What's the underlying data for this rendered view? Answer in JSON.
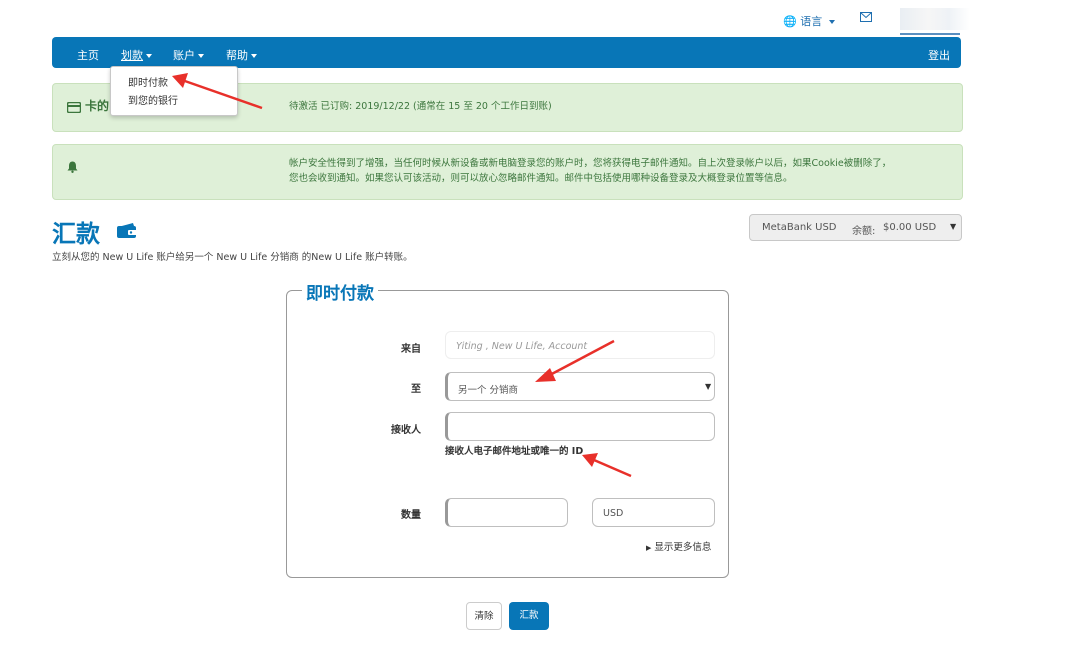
{
  "topbar": {
    "language_label": "语言",
    "globe_icon": "globe-icon",
    "mail_icon": "envelope-icon"
  },
  "nav": {
    "items": [
      "主页",
      "划款",
      "账户",
      "帮助"
    ],
    "logout": "登出"
  },
  "dropdown": {
    "items": [
      "即时付款",
      "到您的银行"
    ]
  },
  "alert1": {
    "title": "卡的",
    "text": "待激活 已订购: 2019/12/22 (通常在 15 至 20 个工作日到账)"
  },
  "alert2": {
    "icon": "bell-icon",
    "line1": "帐户安全性得到了增强，当任何时候从新设备或新电脑登录您的账户时，您将获得电子邮件通知。自上次登录帐户以后，如果Cookie被删除了，",
    "line2": "您也会收到通知。如果您认可该活动，则可以放心忽略邮件通知。邮件中包括使用哪种设备登录及大概登录位置等信息。"
  },
  "heading": {
    "title": "汇款",
    "subtitle": "立刻从您的 New U Life 账户给另一个 New U Life 分销商 的New U Life 账户转账。"
  },
  "account": {
    "name": "MetaBank USD",
    "balance_label": "余额:",
    "balance": "$0.00 USD"
  },
  "form": {
    "legend": "即时付款",
    "from_label": "来自",
    "from_placeholder": "Yiting , New U Life, Account",
    "to_label": "至",
    "to_value": "另一个 分销商",
    "recipient_label": "接收人",
    "recipient_value": "",
    "recipient_help": "接收人电子邮件地址或唯一的 ID",
    "amount_label": "数量",
    "amount_value": "",
    "currency": "USD",
    "more_info": "显示更多信息"
  },
  "buttons": {
    "clear": "清除",
    "transfer": "汇款"
  },
  "colors": {
    "primary": "#0876b7",
    "alert_bg": "#dff0d8",
    "annotation_arrow": "#e8302a"
  }
}
